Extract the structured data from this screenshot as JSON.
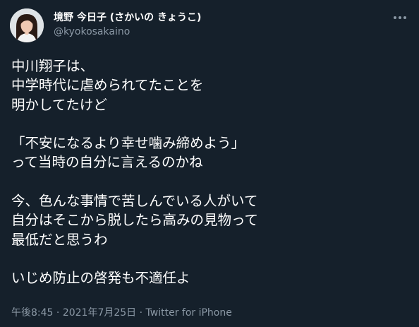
{
  "user": {
    "display_name": "境野 今日子 (さかいの きょうこ)",
    "handle": "@kyokosakaino"
  },
  "tweet": {
    "lines": [
      "中川翔子は、",
      "中学時代に虐められてたことを",
      "明かしてたけど",
      "",
      "「不安になるより幸せ噛み締めよう」",
      "って当時の自分に言えるのかね",
      "",
      "今、色んな事情で苦しんでいる人がいて",
      "自分はそこから脱したら高みの見物って",
      "最低だと思うわ",
      "",
      "いじめ防止の啓発も不適任よ"
    ]
  },
  "meta": {
    "time": "午後8:45",
    "separator": " · ",
    "date": "2021年7月25日",
    "source": "Twitter for iPhone"
  },
  "icons": {
    "avatar": "avatar",
    "more": "more-dots-icon"
  },
  "colors": {
    "background": "#15202b",
    "text_primary": "#ffffff",
    "text_secondary": "#8b98a5"
  }
}
